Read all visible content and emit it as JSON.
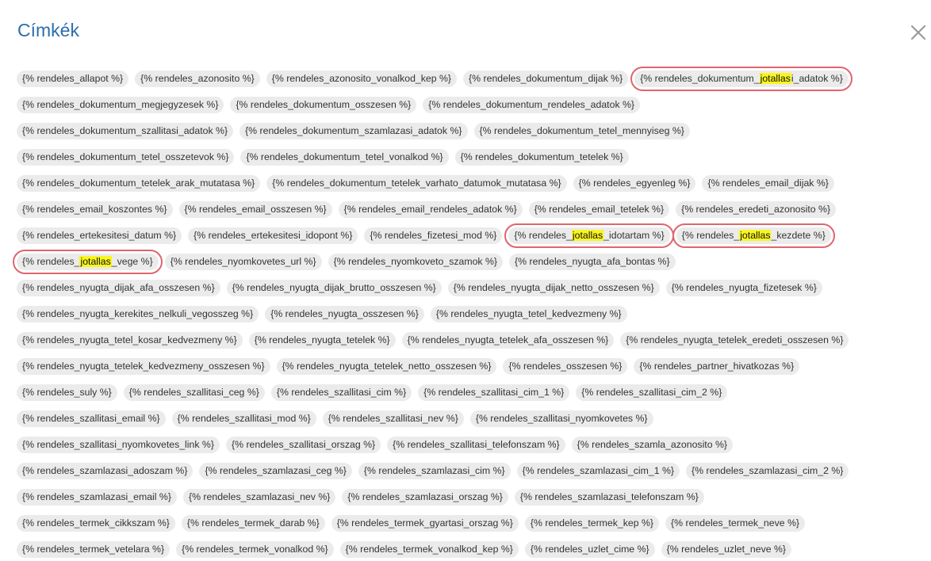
{
  "dialog": {
    "title": "Címkék",
    "close_icon": "close-icon",
    "highlight_term": "jotallas",
    "highlight_color": "#f8f520",
    "box_color": "#e0656f",
    "title_color": "#2b6eac"
  },
  "rows": [
    [
      {
        "text": "{% rendeles_allapot %}"
      },
      {
        "text": "{% rendeles_azonosito %}"
      },
      {
        "text": "{% rendeles_azonosito_vonalkod_kep %}"
      },
      {
        "text": "{% rendeles_dokumentum_dijak %}"
      },
      {
        "pre": "{% rendeles_dokumentum_",
        "hl": "jotallas",
        "post": "i_adatok %}",
        "boxed": true
      }
    ],
    [
      {
        "text": "{% rendeles_dokumentum_megjegyzesek %}"
      },
      {
        "text": "{% rendeles_dokumentum_osszesen %}"
      },
      {
        "text": "{% rendeles_dokumentum_rendeles_adatok %}"
      }
    ],
    [
      {
        "text": "{% rendeles_dokumentum_szallitasi_adatok %}"
      },
      {
        "text": "{% rendeles_dokumentum_szamlazasi_adatok %}"
      },
      {
        "text": "{% rendeles_dokumentum_tetel_mennyiseg %}"
      }
    ],
    [
      {
        "text": "{% rendeles_dokumentum_tetel_osszetevok %}"
      },
      {
        "text": "{% rendeles_dokumentum_tetel_vonalkod %}"
      },
      {
        "text": "{% rendeles_dokumentum_tetelek %}"
      }
    ],
    [
      {
        "text": "{% rendeles_dokumentum_tetelek_arak_mutatasa %}"
      },
      {
        "text": "{% rendeles_dokumentum_tetelek_varhato_datumok_mutatasa %}"
      },
      {
        "text": "{% rendeles_egyenleg %}"
      },
      {
        "text": "{% rendeles_email_dijak %}"
      }
    ],
    [
      {
        "text": "{% rendeles_email_koszontes %}"
      },
      {
        "text": "{% rendeles_email_osszesen %}"
      },
      {
        "text": "{% rendeles_email_rendeles_adatok %}"
      },
      {
        "text": "{% rendeles_email_tetelek %}"
      },
      {
        "text": "{% rendeles_eredeti_azonosito %}"
      }
    ],
    [
      {
        "text": "{% rendeles_ertekesitesi_datum %}"
      },
      {
        "text": "{% rendeles_ertekesitesi_idopont %}"
      },
      {
        "text": "{% rendeles_fizetesi_mod %}"
      },
      {
        "pre": "{% rendeles_",
        "hl": "jotallas",
        "post": "_idotartam %}",
        "boxed": true
      },
      {
        "pre": "{% rendeles_",
        "hl": "jotallas",
        "post": "_kezdete %}",
        "boxed": true
      }
    ],
    [
      {
        "pre": "{% rendeles_",
        "hl": "jotallas",
        "post": "_vege %}",
        "boxed": true
      },
      {
        "text": "{% rendeles_nyomkovetes_url %}"
      },
      {
        "text": "{% rendeles_nyomkoveto_szamok %}"
      },
      {
        "text": "{% rendeles_nyugta_afa_bontas %}"
      }
    ],
    [
      {
        "text": "{% rendeles_nyugta_dijak_afa_osszesen %}"
      },
      {
        "text": "{% rendeles_nyugta_dijak_brutto_osszesen %}"
      },
      {
        "text": "{% rendeles_nyugta_dijak_netto_osszesen %}"
      },
      {
        "text": "{% rendeles_nyugta_fizetesek %}"
      }
    ],
    [
      {
        "text": "{% rendeles_nyugta_kerekites_nelkuli_vegosszeg %}"
      },
      {
        "text": "{% rendeles_nyugta_osszesen %}"
      },
      {
        "text": "{% rendeles_nyugta_tetel_kedvezmeny %}"
      }
    ],
    [
      {
        "text": "{% rendeles_nyugta_tetel_kosar_kedvezmeny %}"
      },
      {
        "text": "{% rendeles_nyugta_tetelek %}"
      },
      {
        "text": "{% rendeles_nyugta_tetelek_afa_osszesen %}"
      },
      {
        "text": "{% rendeles_nyugta_tetelek_eredeti_osszesen %}"
      }
    ],
    [
      {
        "text": "{% rendeles_nyugta_tetelek_kedvezmeny_osszesen %}"
      },
      {
        "text": "{% rendeles_nyugta_tetelek_netto_osszesen %}"
      },
      {
        "text": "{% rendeles_osszesen %}"
      },
      {
        "text": "{% rendeles_partner_hivatkozas %}"
      }
    ],
    [
      {
        "text": "{% rendeles_suly %}"
      },
      {
        "text": "{% rendeles_szallitasi_ceg %}"
      },
      {
        "text": "{% rendeles_szallitasi_cim %}"
      },
      {
        "text": "{% rendeles_szallitasi_cim_1 %}"
      },
      {
        "text": "{% rendeles_szallitasi_cim_2 %}"
      }
    ],
    [
      {
        "text": "{% rendeles_szallitasi_email %}"
      },
      {
        "text": "{% rendeles_szallitasi_mod %}"
      },
      {
        "text": "{% rendeles_szallitasi_nev %}"
      },
      {
        "text": "{% rendeles_szallitasi_nyomkovetes %}"
      }
    ],
    [
      {
        "text": "{% rendeles_szallitasi_nyomkovetes_link %}"
      },
      {
        "text": "{% rendeles_szallitasi_orszag %}"
      },
      {
        "text": "{% rendeles_szallitasi_telefonszam %}"
      },
      {
        "text": "{% rendeles_szamla_azonosito %}"
      }
    ],
    [
      {
        "text": "{% rendeles_szamlazasi_adoszam %}"
      },
      {
        "text": "{% rendeles_szamlazasi_ceg %}"
      },
      {
        "text": "{% rendeles_szamlazasi_cim %}"
      },
      {
        "text": "{% rendeles_szamlazasi_cim_1 %}"
      },
      {
        "text": "{% rendeles_szamlazasi_cim_2 %}"
      }
    ],
    [
      {
        "text": "{% rendeles_szamlazasi_email %}"
      },
      {
        "text": "{% rendeles_szamlazasi_nev %}"
      },
      {
        "text": "{% rendeles_szamlazasi_orszag %}"
      },
      {
        "text": "{% rendeles_szamlazasi_telefonszam %}"
      }
    ],
    [
      {
        "text": "{% rendeles_termek_cikkszam %}"
      },
      {
        "text": "{% rendeles_termek_darab %}"
      },
      {
        "text": "{% rendeles_termek_gyartasi_orszag %}"
      },
      {
        "text": "{% rendeles_termek_kep %}"
      },
      {
        "text": "{% rendeles_termek_neve %}"
      }
    ],
    [
      {
        "text": "{% rendeles_termek_vetelara %}"
      },
      {
        "text": "{% rendeles_termek_vonalkod %}"
      },
      {
        "text": "{% rendeles_termek_vonalkod_kep %}"
      },
      {
        "text": "{% rendeles_uzlet_cime %}"
      },
      {
        "text": "{% rendeles_uzlet_neve %}"
      }
    ]
  ]
}
